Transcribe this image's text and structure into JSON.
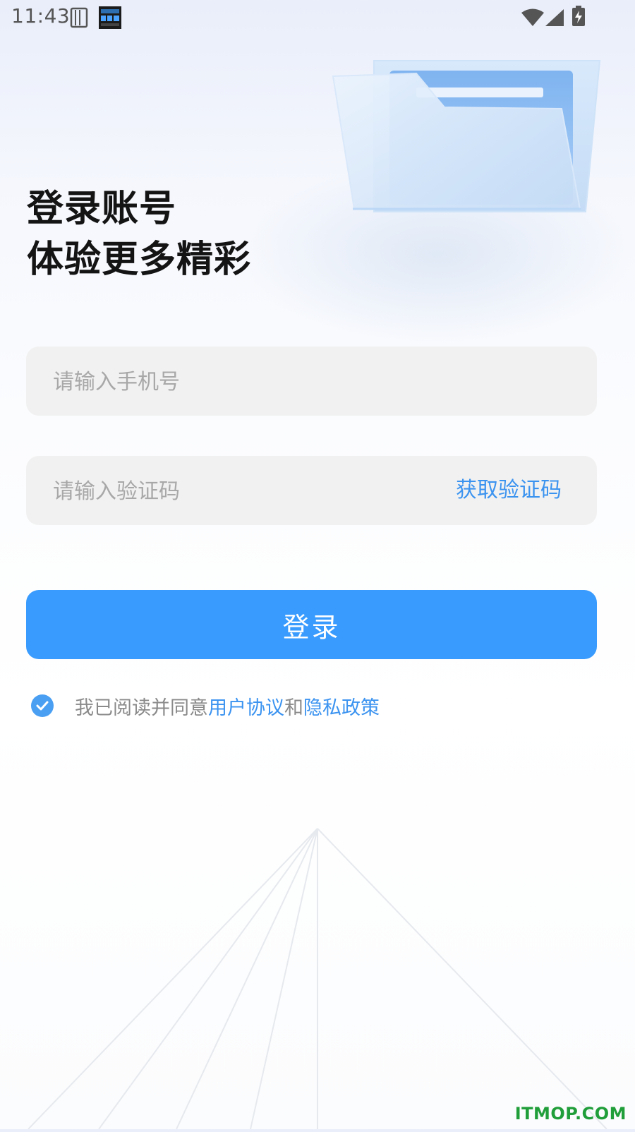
{
  "status_bar": {
    "time": "11:43",
    "left_icons": [
      "sim-card-icon",
      "clock-widget-icon"
    ],
    "right_icons": [
      "wifi-icon",
      "cell-signal-icon",
      "battery-charging-icon"
    ]
  },
  "hero": {
    "line1": "登录账号",
    "line2": "体验更多精彩",
    "illustration_icon": "folder-icon"
  },
  "form": {
    "phone_placeholder": "请输入手机号",
    "code_placeholder": "请输入验证码",
    "get_code_label": "获取验证码",
    "login_label": "登录"
  },
  "agreement": {
    "checked": true,
    "prefix": "我已阅读并同意",
    "user_agreement": "用户协议",
    "and": "和",
    "privacy_policy": "隐私政策"
  },
  "watermark": "ITMOP.COM",
  "colors": {
    "accent": "#389bfd",
    "link": "#3b93f0",
    "field_bg": "#f1f1f1",
    "watermark": "#1f9e3a"
  }
}
